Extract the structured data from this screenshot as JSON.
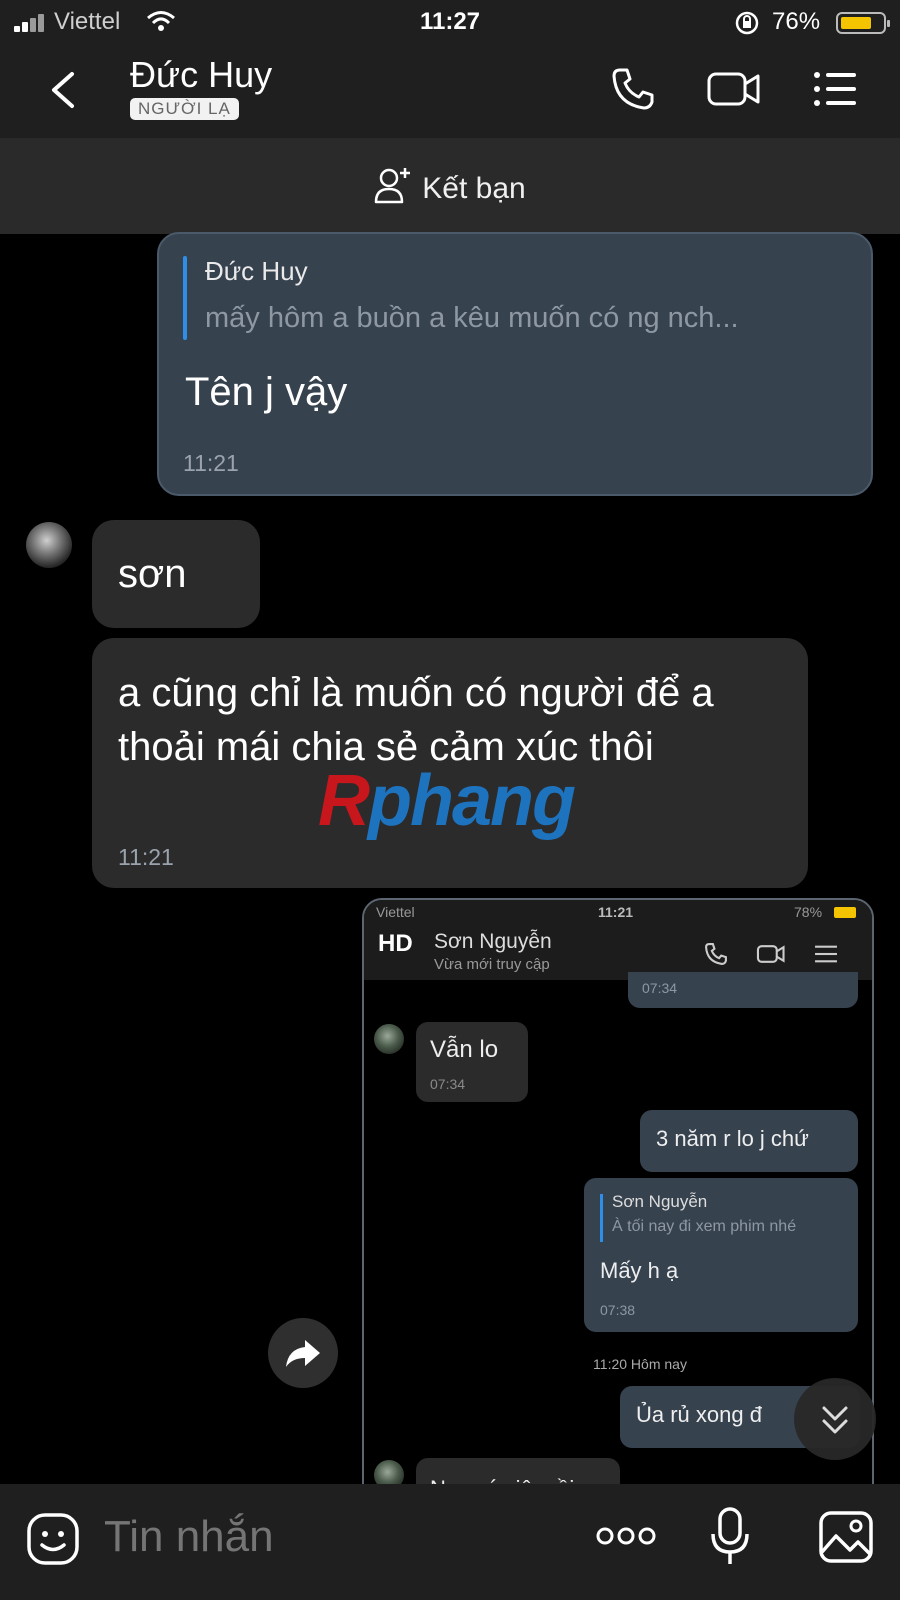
{
  "status_bar": {
    "carrier": "Viettel",
    "time": "11:27",
    "battery_percent": "76%",
    "battery_level": 0.76
  },
  "header": {
    "contact_name": "Đức Huy",
    "tag": "NGƯỜI LẠ",
    "icons": [
      "back-chevron-icon",
      "phone-icon",
      "video-call-icon",
      "menu-list-icon"
    ]
  },
  "add_friend_bar": {
    "label": "Kết bạn"
  },
  "messages": [
    {
      "direction": "outgoing",
      "quote_author": "Đức Huy",
      "quote_text": "mấy hôm a buồn a kêu muốn có ng nch...",
      "text": "Tên j vậy",
      "time": "11:21"
    },
    {
      "direction": "incoming",
      "text": "sơn"
    },
    {
      "direction": "incoming",
      "text": "a cũng chỉ là muốn có người để a thoải mái chia sẻ cảm xúc thôi",
      "time": "11:21"
    }
  ],
  "watermark": {
    "part1": "R",
    "part2": "phang"
  },
  "shared_screenshot": {
    "status": {
      "carrier": "Viettel",
      "time": "11:21",
      "battery": "78%"
    },
    "hd_label": "HD",
    "contact_name": "Sơn Nguyễn",
    "presence": "Vừa mới truy cập",
    "messages": [
      {
        "direction": "outgoing",
        "time": "07:34"
      },
      {
        "direction": "incoming",
        "text": "Vẫn lo",
        "time": "07:34"
      },
      {
        "direction": "outgoing",
        "text": "3 năm r lo j chứ"
      },
      {
        "direction": "outgoing",
        "quote_author": "Sơn Nguyễn",
        "quote_text": "À tối nay đi xem phim nhé",
        "text": "Mấy h ạ",
        "time": "07:38"
      },
      {
        "direction": "outgoing",
        "text": "Ủa rủ xong đ"
      },
      {
        "direction": "incoming",
        "text": "Nay có việc rồi"
      }
    ],
    "date_divider": "11:20 Hôm nay"
  },
  "composer": {
    "placeholder": "Tin nhắn",
    "icons": [
      "sticker-icon",
      "more-dots-icon",
      "microphone-icon",
      "image-icon"
    ]
  },
  "colors": {
    "background": "#000000",
    "header": "#1f1f1f",
    "outgoing_bubble": "#37424f",
    "incoming_bubble": "#2b2b2b",
    "quote_bar": "#2f8fe8",
    "battery": "#f5c400"
  }
}
